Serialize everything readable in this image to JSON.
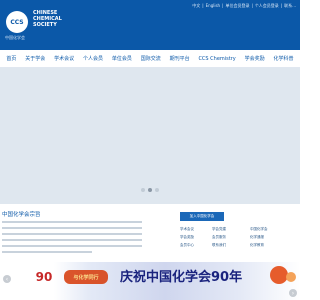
{
  "header": {
    "logo_text": "CCS",
    "org_name_lines": [
      "CHINESE",
      "CHEMICAL",
      "SOCIETY"
    ],
    "org_name_cn": "中国化学会",
    "top_links": [
      "中文",
      "|",
      "English",
      "|",
      "单位会员登录",
      "|",
      "个人会员登录",
      "|",
      "联系..."
    ]
  },
  "nav": {
    "items": [
      "首页",
      "关于学会",
      "学术会议",
      "个人会员",
      "单位会员",
      "国际交流",
      "期刊平台",
      "CCS Chemistry",
      "学会奖励",
      "化学科普"
    ]
  },
  "banner": {
    "dots": 3,
    "active_dot": 2
  },
  "main": {
    "mission_title": "中国化学会宗旨",
    "join_button": "加入中国化学会",
    "quick_links_col1": [
      "学术会议",
      "学会奖励",
      "会员中心"
    ],
    "quick_links_col2": [
      "学会党建",
      "会员服务",
      "联系我们"
    ],
    "quick_links_col3": [
      "中国化学会",
      "化学通报",
      "化学教育"
    ]
  },
  "bottom_banner": {
    "badge_text": "90",
    "script_text": "与化学同行",
    "celebrate_text": "庆祝中国化学会90年",
    "left_arrow": "‹",
    "right_arrow": "›"
  },
  "colors": {
    "brand_blue": "#0b58a8",
    "nav_text": "#0b58a8",
    "banner_bg": "#dfe7ef"
  }
}
